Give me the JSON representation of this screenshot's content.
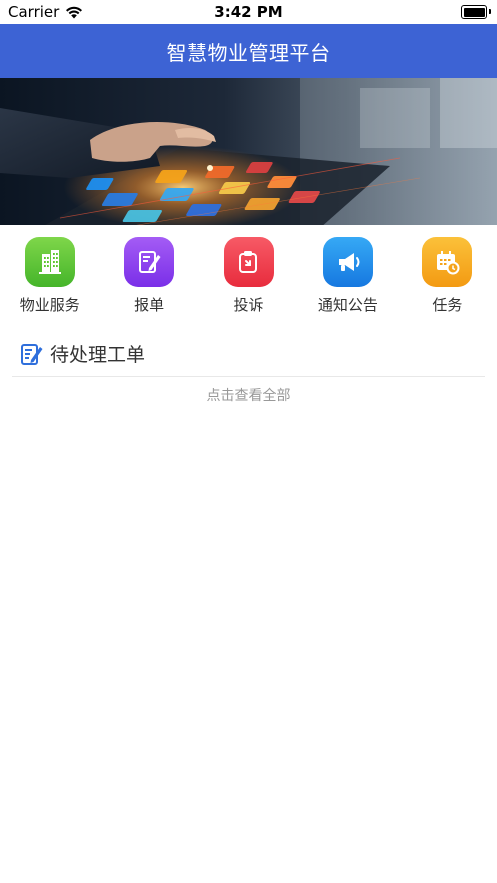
{
  "status_bar": {
    "carrier": "Carrier",
    "time": "3:42 PM"
  },
  "nav": {
    "title": "智慧物业管理平台"
  },
  "shortcuts": [
    {
      "label": "物业服务",
      "icon": "building-icon",
      "color": "#5cc72f"
    },
    {
      "label": "报单",
      "icon": "document-pen-icon",
      "color": "#8a3cf0"
    },
    {
      "label": "投诉",
      "icon": "complaint-icon",
      "color": "#f0394a"
    },
    {
      "label": "通知公告",
      "icon": "megaphone-icon",
      "color": "#1e8ff0"
    },
    {
      "label": "任务",
      "icon": "calendar-clock-icon",
      "color": "#f5a31a"
    }
  ],
  "pending": {
    "title": "待处理工单",
    "view_all": "点击查看全部"
  },
  "colors": {
    "nav_bg": "#3d63d4"
  }
}
